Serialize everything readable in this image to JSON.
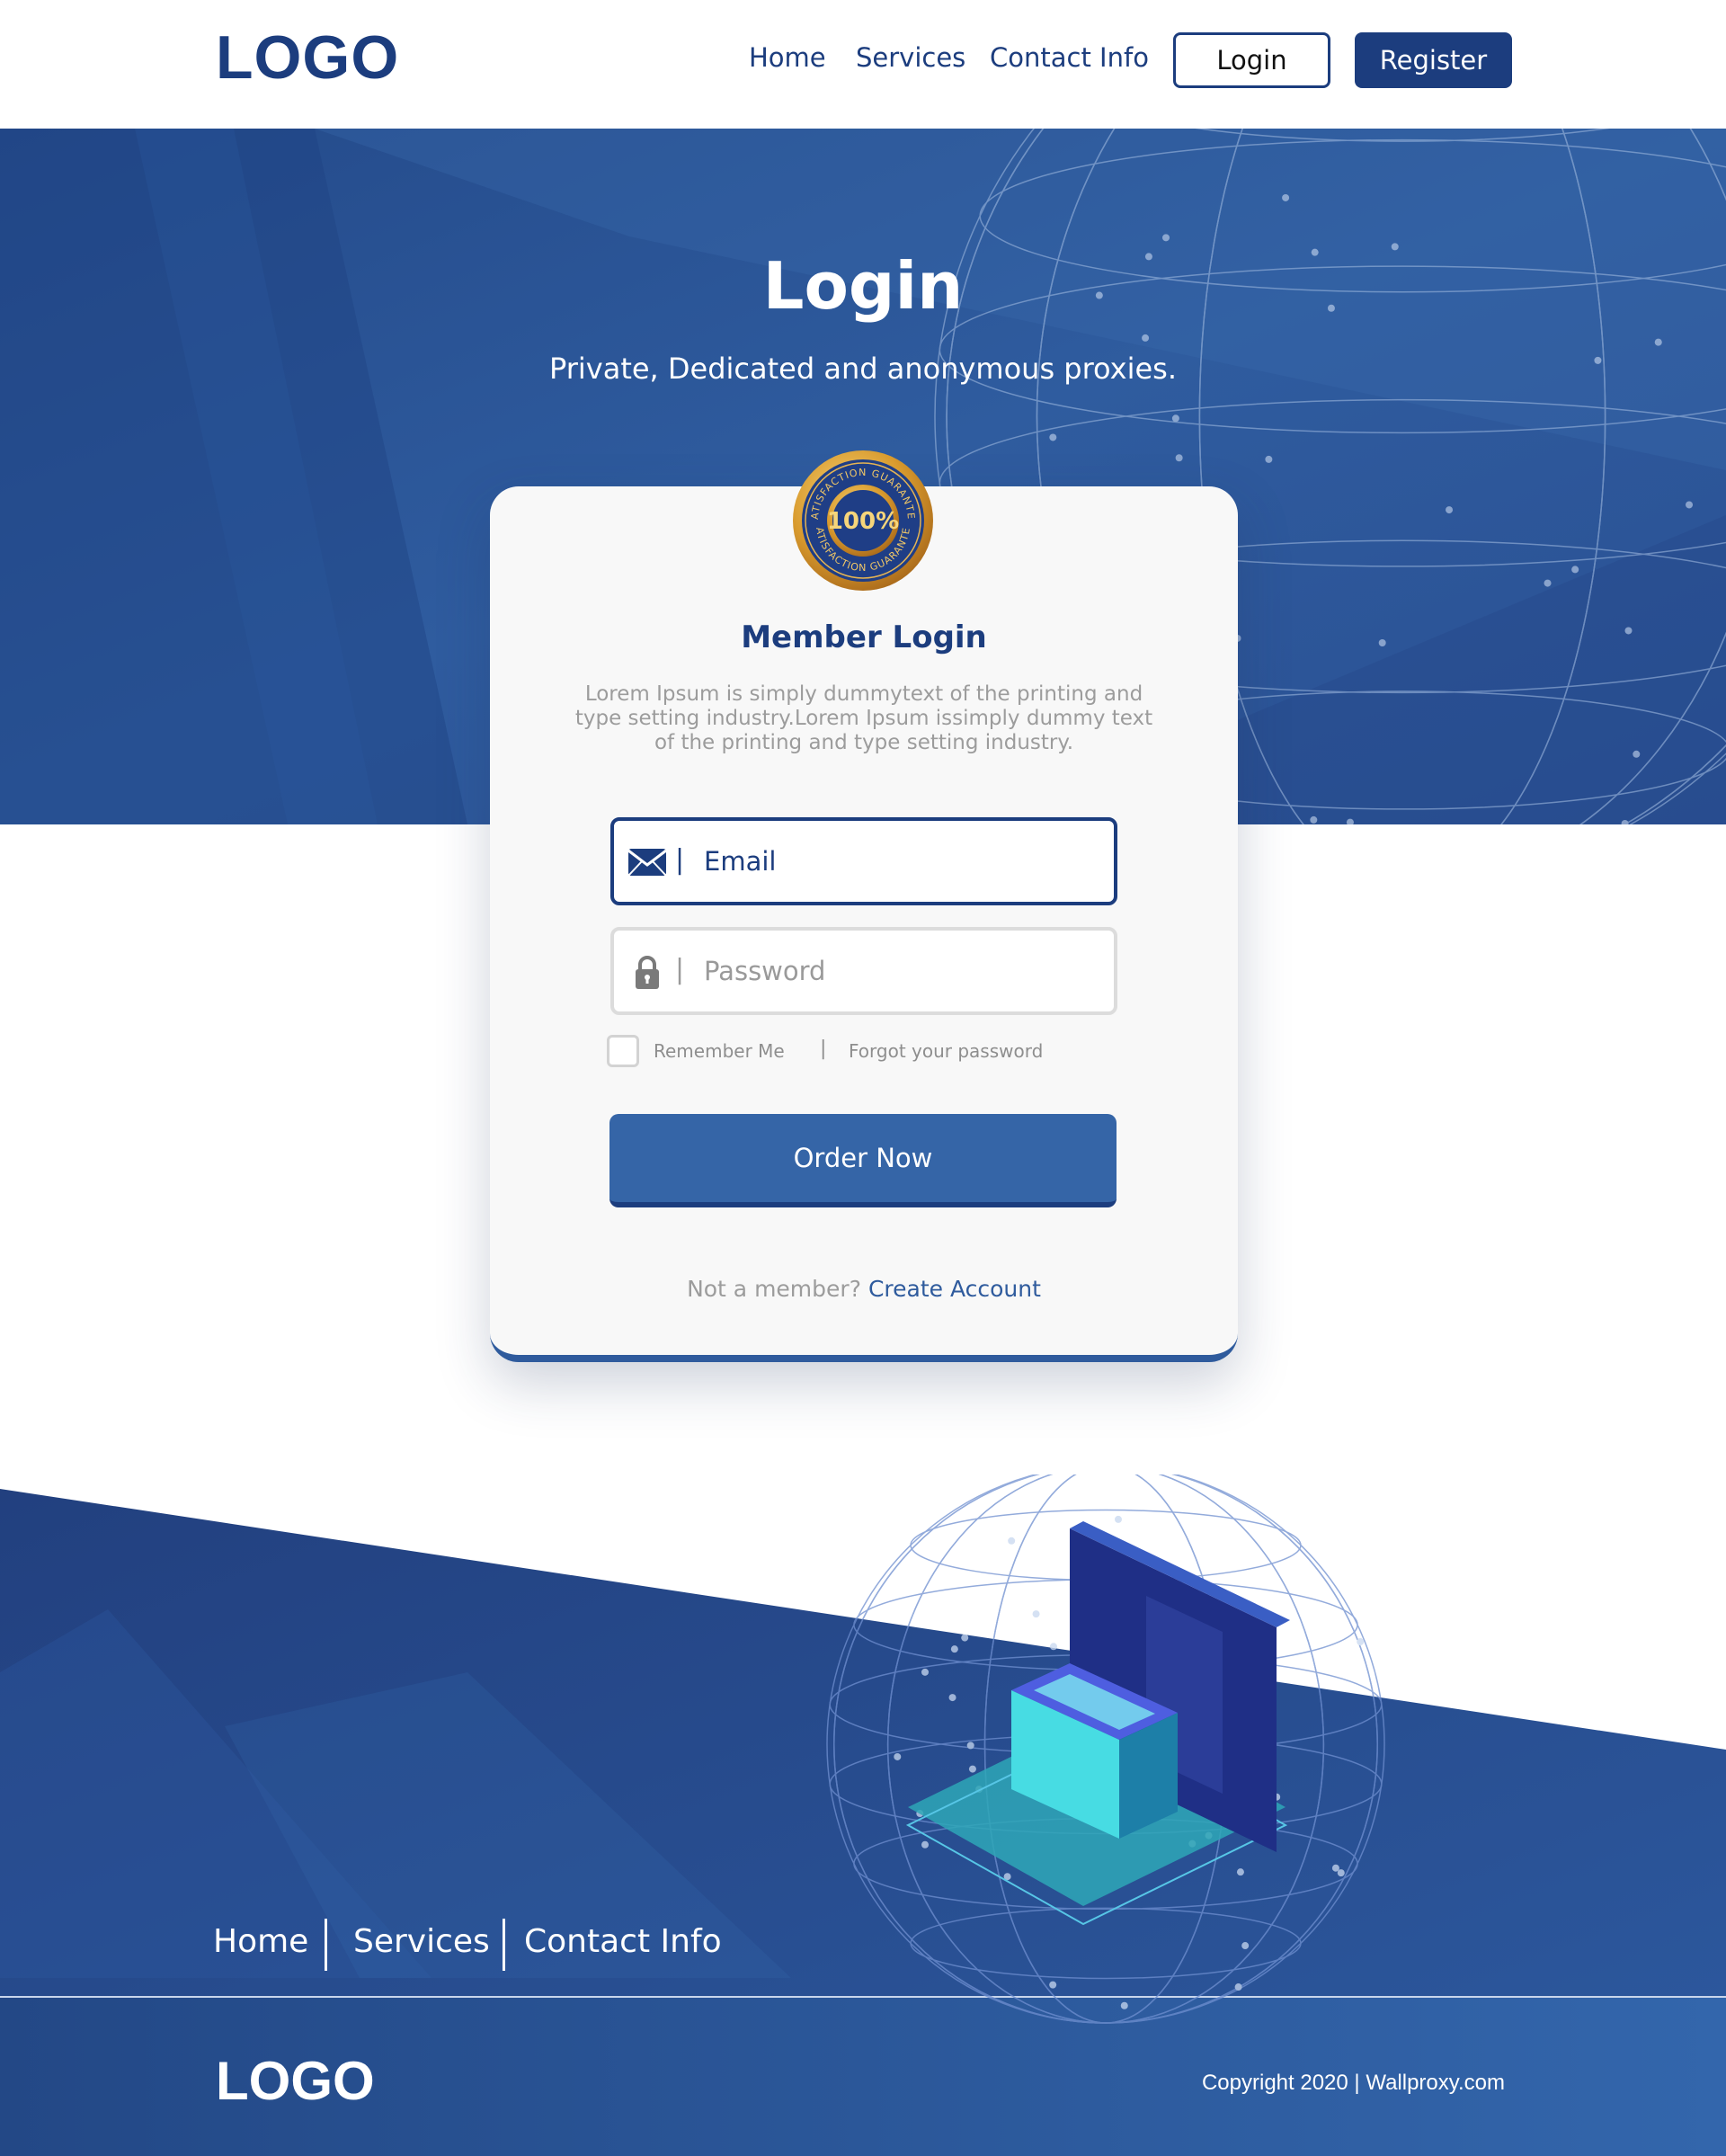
{
  "header": {
    "logo": "LOGO",
    "nav": [
      {
        "label": "Home"
      },
      {
        "label": "Services"
      },
      {
        "label": "Contact Info"
      }
    ],
    "login_label": "Login",
    "register_label": "Register"
  },
  "hero": {
    "title": "Login",
    "subtitle": "Private, Dedicated and anonymous proxies."
  },
  "badge": {
    "center_text": "100%",
    "ring_text": "SATISFACTION GUARANTEE"
  },
  "card": {
    "title": "Member Login",
    "description": "Lorem Ipsum is simply dummytext of the printing and type setting industry.Lorem Ipsum issimply dummy text of the printing and type setting industry.",
    "email_placeholder": "Email",
    "password_placeholder": "Password",
    "field_separator": "|",
    "remember_label": "Remember Me",
    "separator": "|",
    "forgot_label": "Forgot your password",
    "order_button": "Order Now",
    "not_member_text": "Not a member?",
    "create_account": "Create Account"
  },
  "footer": {
    "nav": [
      {
        "label": "Home"
      },
      {
        "label": "Services"
      },
      {
        "label": "Contact Info"
      }
    ],
    "social_icons": [
      "facebook-icon",
      "linkedin-icon",
      "twitter-icon",
      "instagram-icon"
    ],
    "logo": "LOGO",
    "copyright": "Copyright 2020 | Wallproxy.com"
  },
  "colors": {
    "brand_navy": "#1c3d7e",
    "brand_blue": "#3565a7",
    "hero_blue": "#2b5496",
    "muted_text": "#9c9c9c"
  }
}
